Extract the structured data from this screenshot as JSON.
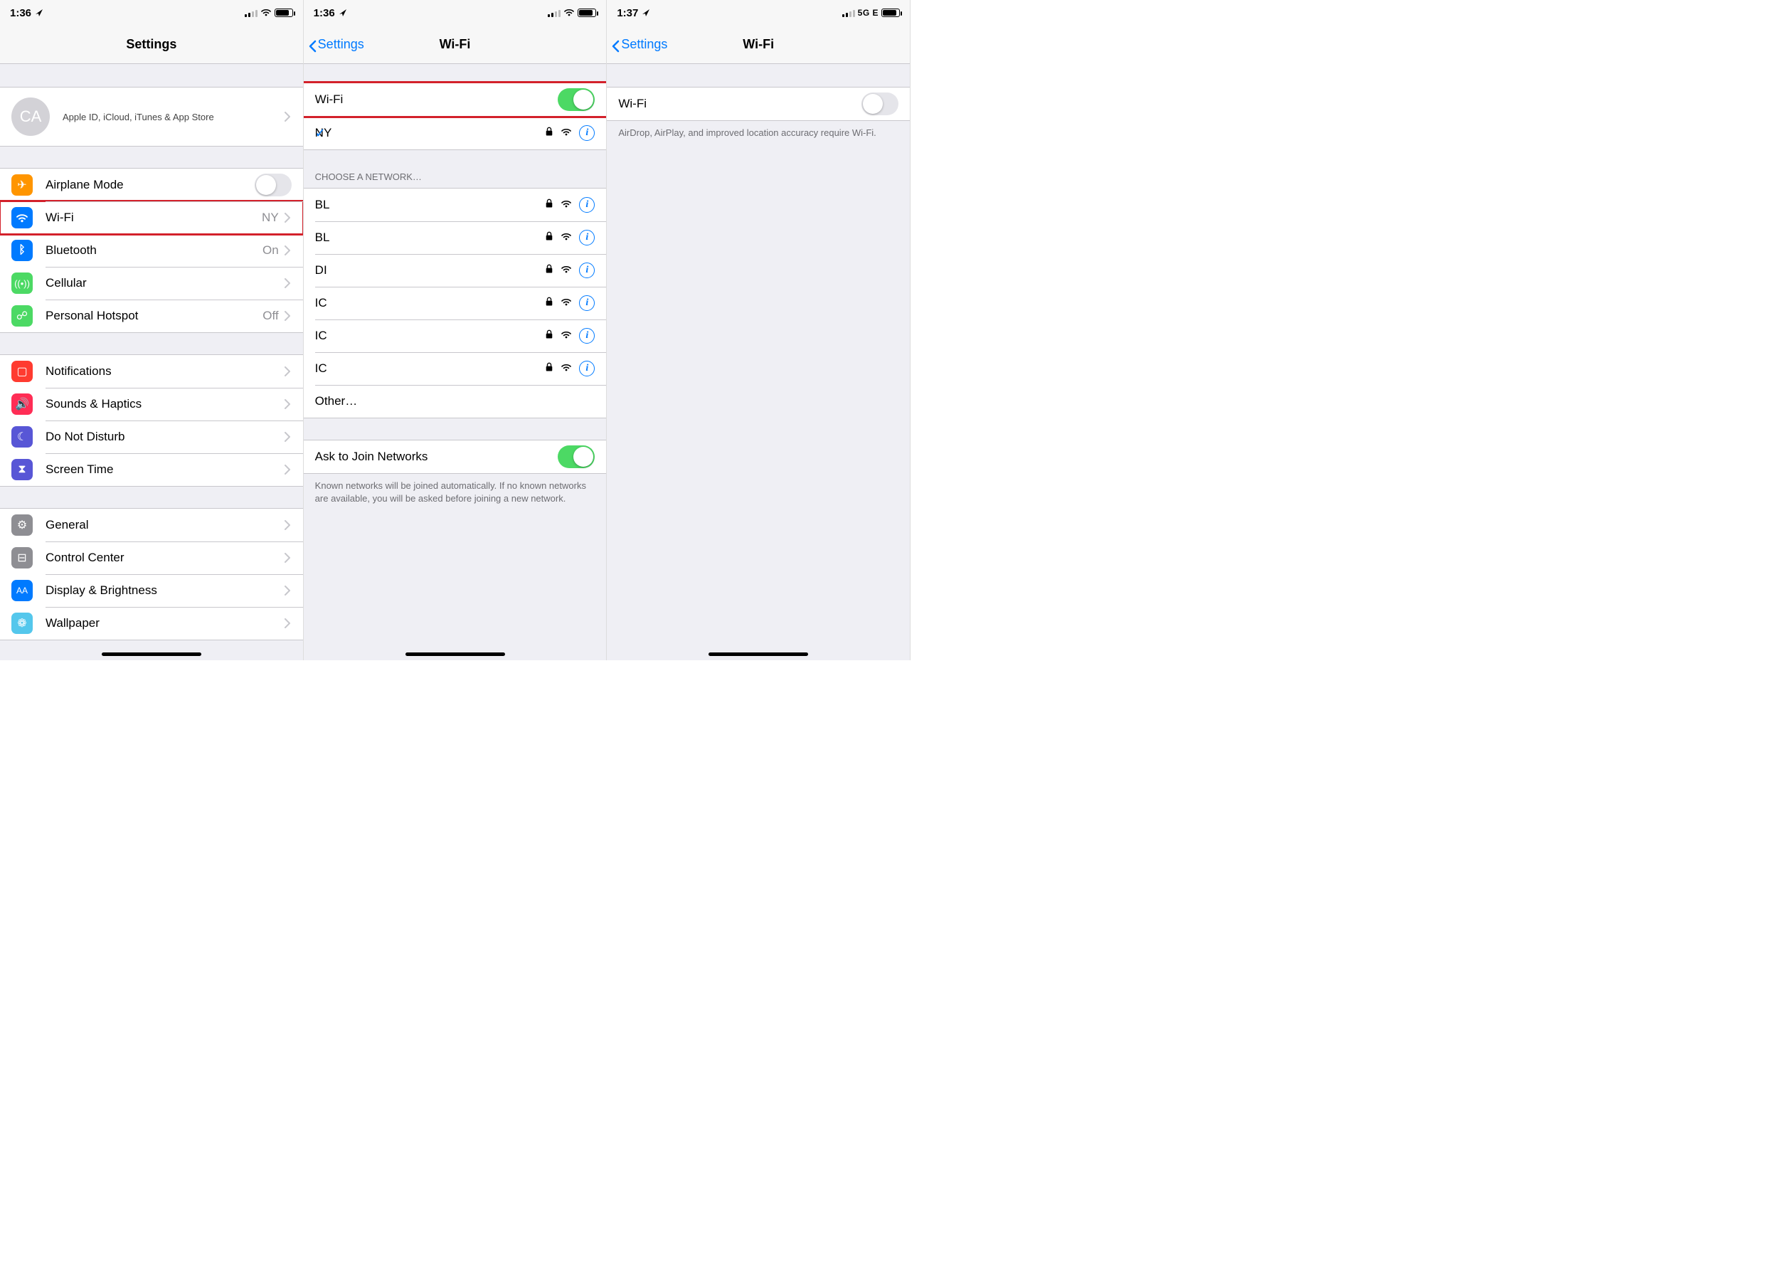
{
  "panel1": {
    "time": "1:36",
    "title": "Settings",
    "avatar_initials": "CA",
    "appleid_sub": "Apple ID, iCloud, iTunes & App Store",
    "rows": {
      "airplane": "Airplane Mode",
      "wifi": "Wi-Fi",
      "wifi_val": "NY",
      "bluetooth": "Bluetooth",
      "bluetooth_val": "On",
      "cellular": "Cellular",
      "hotspot": "Personal Hotspot",
      "hotspot_val": "Off",
      "notifications": "Notifications",
      "sounds": "Sounds & Haptics",
      "dnd": "Do Not Disturb",
      "screentime": "Screen Time",
      "general": "General",
      "control": "Control Center",
      "display": "Display & Brightness",
      "wallpaper": "Wallpaper"
    },
    "icons": {
      "airplane_color": "#ff9500",
      "wifi_color": "#007aff",
      "bluetooth_color": "#007aff",
      "cellular_color": "#4cd964",
      "hotspot_color": "#4cd964",
      "notifications_color": "#ff3b30",
      "sounds_color": "#ff2d55",
      "dnd_color": "#5856d6",
      "screentime_color": "#5856d6",
      "general_color": "#8e8e93",
      "control_color": "#8e8e93",
      "display_color": "#007aff",
      "wallpaper_color": "#54c7ec"
    }
  },
  "panel2": {
    "time": "1:36",
    "back": "Settings",
    "title": "Wi-Fi",
    "wifi_label": "Wi-Fi",
    "wifi_on": true,
    "connected": {
      "name": "NY",
      "locked": true
    },
    "choose_header": "CHOOSE A NETWORK…",
    "networks": [
      {
        "name": "BL",
        "locked": true
      },
      {
        "name": "BL",
        "locked": true
      },
      {
        "name": "DI",
        "locked": true
      },
      {
        "name": "IC",
        "locked": true
      },
      {
        "name": "IC",
        "locked": true
      },
      {
        "name": "IC",
        "locked": true
      }
    ],
    "other": "Other…",
    "ask_label": "Ask to Join Networks",
    "ask_on": true,
    "ask_footer": "Known networks will be joined automatically. If no known networks are available, you will be asked before joining a new network."
  },
  "panel3": {
    "time": "1:37",
    "net_type": "5G E",
    "back": "Settings",
    "title": "Wi-Fi",
    "wifi_label": "Wi-Fi",
    "wifi_on": false,
    "footer": "AirDrop, AirPlay, and improved location accuracy require Wi-Fi."
  }
}
